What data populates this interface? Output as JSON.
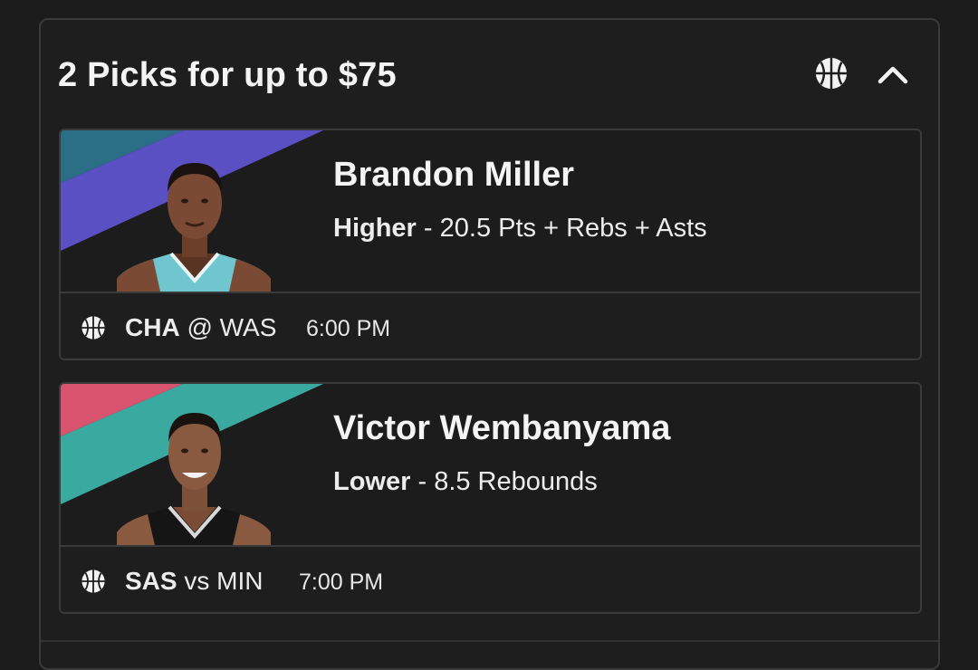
{
  "header": {
    "title": "2 Picks for up to $75",
    "sport_icon": "basketball-icon",
    "collapse_icon": "chevron-up-icon"
  },
  "picks": [
    {
      "player": "Brandon Miller",
      "direction": "Higher",
      "separator": " - ",
      "line": "20.5 Pts + Rebs + Asts",
      "team": "CHA",
      "connector": "@",
      "opponent": "WAS",
      "time": "6:00 PM",
      "colors": {
        "primary": "#2a6f86",
        "secondary": "#5b4fc4",
        "jersey": "#6fc6cf"
      }
    },
    {
      "player": "Victor Wembanyama",
      "direction": "Lower",
      "separator": " - ",
      "line": "8.5 Rebounds",
      "team": "SAS",
      "connector": "vs",
      "opponent": "MIN",
      "time": "7:00 PM",
      "colors": {
        "primary": "#d9536e",
        "secondary": "#3aa9a0",
        "jersey": "#151515"
      }
    }
  ]
}
